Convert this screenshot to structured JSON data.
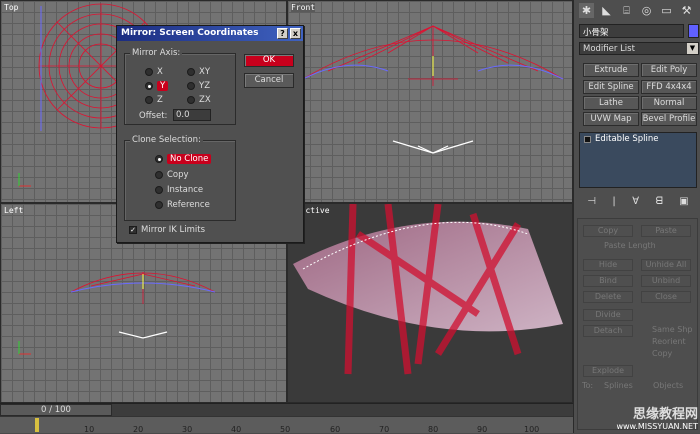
{
  "viewports": {
    "top": "Top",
    "front": "Front",
    "left": "Left",
    "perspective": "spective"
  },
  "dialog": {
    "title": "Mirror: Screen Coordinates",
    "help_btn": "?",
    "close_btn": "x",
    "mirror_axis_title": "Mirror Axis:",
    "axes": [
      "X",
      "Y",
      "Z",
      "XY",
      "YZ",
      "ZX"
    ],
    "selected_axis": "Y",
    "offset_label": "Offset:",
    "offset_value": "0.0",
    "clone_title": "Clone Selection:",
    "clone_options": [
      "No Clone",
      "Copy",
      "Instance",
      "Reference"
    ],
    "selected_clone": "No Clone",
    "ik_label": "Mirror IK Limits",
    "ik_checked": true,
    "ok": "OK",
    "cancel": "Cancel"
  },
  "panel": {
    "object_name": "小骨架",
    "modifier_list": "Modifier List",
    "buttons": [
      "Extrude",
      "Edit Poly",
      "Edit Spline",
      "FFD 4x4x4",
      "Lathe",
      "Normal",
      "UVW Map",
      "Bevel Profile"
    ],
    "stack_item": "Editable Spline",
    "disabled": [
      "Copy",
      "Paste",
      "Paste Length",
      "Hide",
      "Unhide All",
      "Bind",
      "Unbind",
      "Delete",
      "Close",
      "Divide",
      "Detach",
      "Same Shp",
      "Reorient",
      "Copy",
      "Explode",
      "To:",
      "Splines",
      "Objects"
    ]
  },
  "timeline": {
    "slider": "0 / 100",
    "ticks": [
      "10",
      "20",
      "30",
      "40",
      "50",
      "60",
      "70",
      "80",
      "90",
      "100"
    ]
  },
  "watermark": {
    "line1": "思缘教程网",
    "line2": "www.MISSYUAN.NET"
  }
}
